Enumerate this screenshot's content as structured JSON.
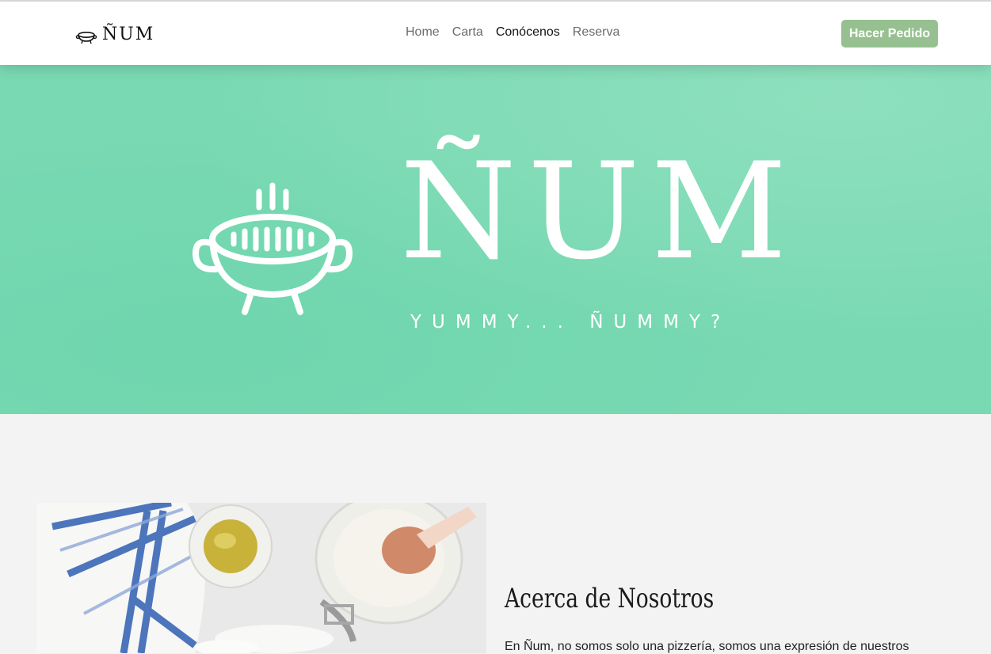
{
  "navbar": {
    "brand": "ÑUM",
    "links": [
      {
        "label": "Home",
        "active": false
      },
      {
        "label": "Carta",
        "active": false
      },
      {
        "label": "Conócenos",
        "active": true
      },
      {
        "label": "Reserva",
        "active": false
      }
    ],
    "order_button": "Hacer Pedido"
  },
  "hero": {
    "title": "ÑUM",
    "tagline": "YUMMY... ÑUMMY?",
    "background_color": "#79d9b3"
  },
  "about": {
    "title": "Acerca de Nosotros",
    "text": "En Ñum, no somos solo una pizzería, somos una expresión de nuestros"
  },
  "colors": {
    "accent_button": "#96c090",
    "hero_green": "#79d9b3",
    "page_background": "#f3f3f3"
  },
  "icons": {
    "brand": "pot-icon",
    "hero": "pot-icon"
  }
}
